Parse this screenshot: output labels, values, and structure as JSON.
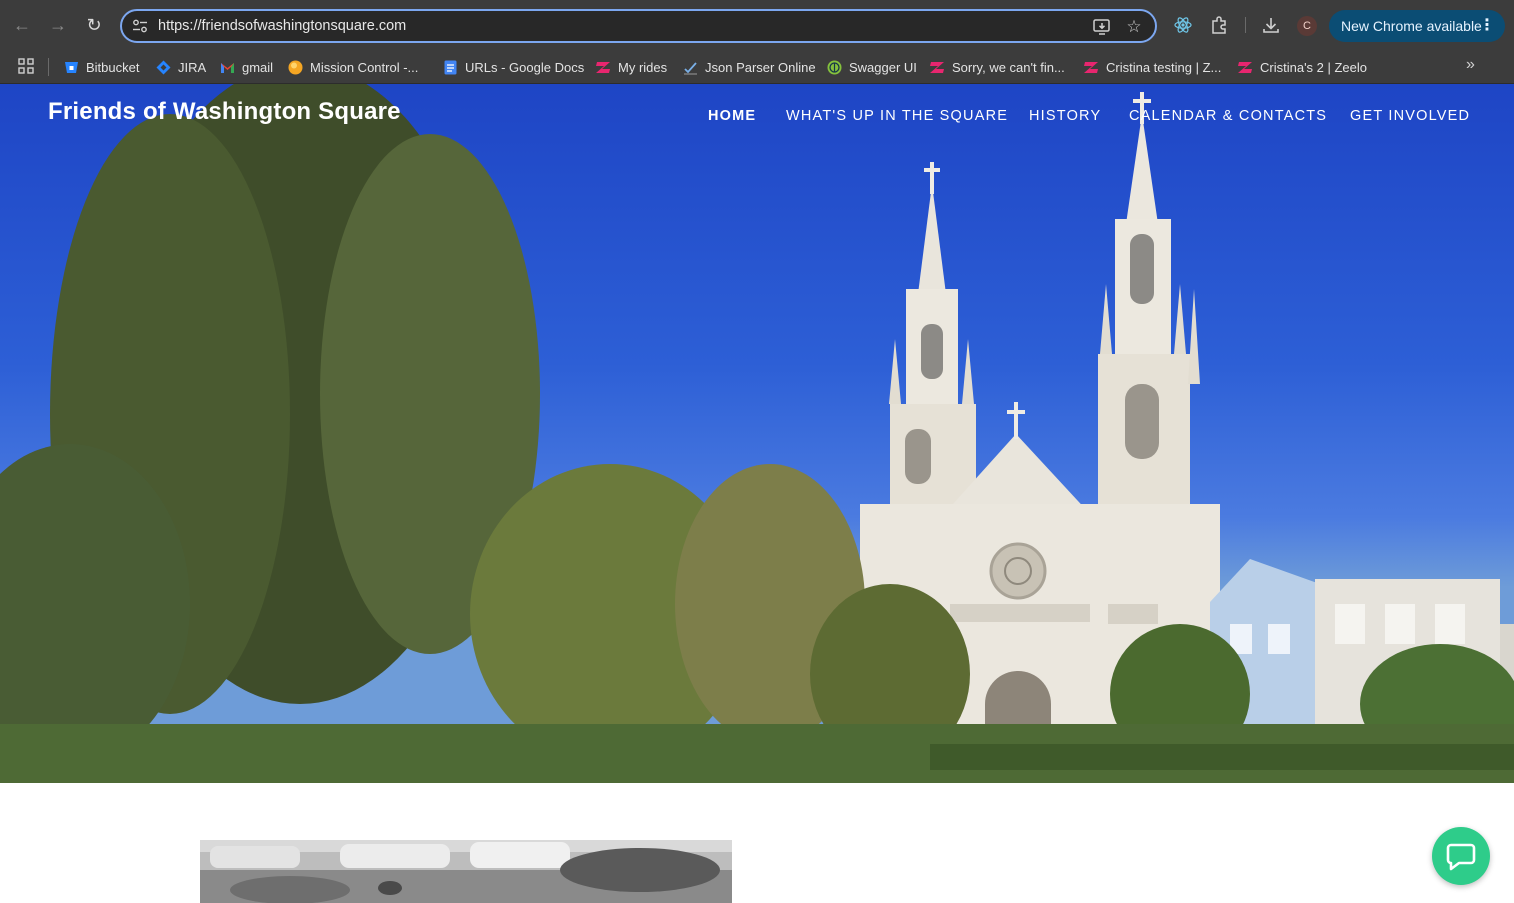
{
  "browser": {
    "address": "https://friendsofwashingtonsquare.com",
    "profile_initial": "C",
    "update_label": "New Chrome available",
    "update_menu_glyph": "⋮",
    "overflow_glyph": "»",
    "accent_color": "#7ca7f0"
  },
  "bookmarks": [
    {
      "label": "Bitbucket",
      "icon": "bitbucket-icon"
    },
    {
      "label": "JIRA",
      "icon": "jira-icon"
    },
    {
      "label": "gmail",
      "icon": "gmail-icon"
    },
    {
      "label": "Mission Control -...",
      "icon": "mission-control-icon"
    },
    {
      "label": "URLs - Google Docs",
      "icon": "google-docs-icon"
    },
    {
      "label": "My rides",
      "icon": "zeelo-icon"
    },
    {
      "label": "Json Parser Online",
      "icon": "json-parser-icon"
    },
    {
      "label": "Swagger UI",
      "icon": "swagger-icon"
    },
    {
      "label": "Sorry, we can't fin...",
      "icon": "zeelo-icon"
    },
    {
      "label": "Cristina testing | Z...",
      "icon": "zeelo-icon"
    },
    {
      "label": "Cristina's 2 | Zeelo",
      "icon": "zeelo-icon"
    }
  ],
  "site": {
    "title": "Friends of Washington Square",
    "nav": [
      {
        "label": "HOME",
        "current": true
      },
      {
        "label": "WHAT'S UP IN THE SQUARE",
        "current": false
      },
      {
        "label": "HISTORY",
        "current": false
      },
      {
        "label": "CALENDAR & CONTACTS",
        "current": false
      },
      {
        "label": "GET INVOLVED",
        "current": false
      }
    ],
    "chat_color": "#2ecc8a"
  }
}
